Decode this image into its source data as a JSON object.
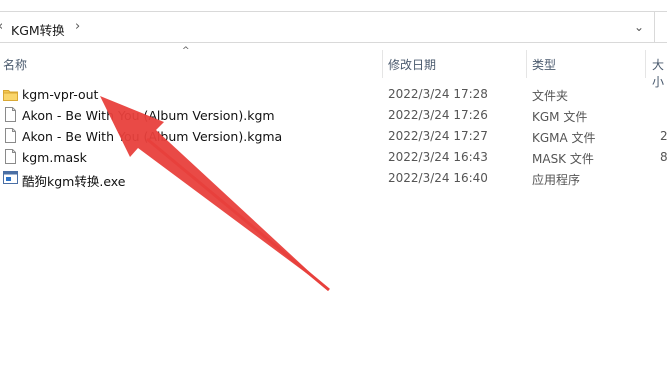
{
  "address_bar": {
    "breadcrumb": "KGM转换",
    "separator": "›",
    "back_chevron": "‹",
    "dropdown": "⌄"
  },
  "columns": {
    "sort_indicator": "^",
    "name": "名称",
    "date_modified": "修改日期",
    "type": "类型",
    "size": "大小"
  },
  "files": [
    {
      "name": "kgm-vpr-out",
      "date": "2022/3/24 17:28",
      "type": "文件夹",
      "size": "",
      "icon": "folder-icon"
    },
    {
      "name": "Akon - Be With You (Album Version).kgm",
      "date": "2022/3/24 17:26",
      "type": "KGM 文件",
      "size": "",
      "icon": "file-icon"
    },
    {
      "name": "Akon - Be With You (Album Version).kgma",
      "date": "2022/3/24 17:27",
      "type": "KGMA 文件",
      "size": "2",
      "icon": "file-icon"
    },
    {
      "name": "kgm.mask",
      "date": "2022/3/24 16:43",
      "type": "MASK 文件",
      "size": "8",
      "icon": "file-icon"
    },
    {
      "name": "酷狗kgm转换.exe",
      "date": "2022/3/24 16:40",
      "type": "应用程序",
      "size": "",
      "icon": "exe-icon"
    }
  ],
  "colors": {
    "arrow": "#e8403c",
    "folder": "#f5c851",
    "header_text": "#4a5a6e"
  }
}
